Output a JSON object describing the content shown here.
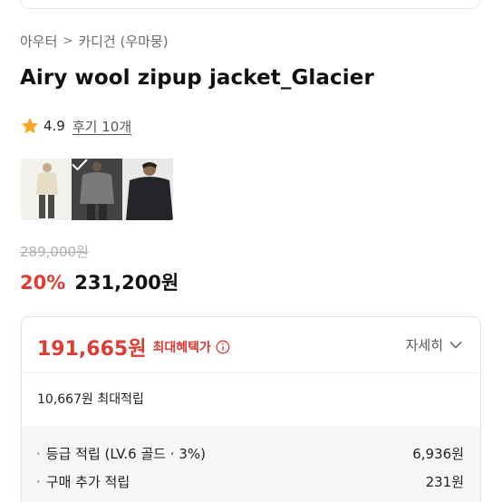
{
  "breadcrumb": {
    "parent": "아우터",
    "separator": ">",
    "current": "카디건 (우마뭉)"
  },
  "product": {
    "title": "Airy wool zipup jacket_Glacier"
  },
  "rating": {
    "score": "4.9",
    "reviews_label": "후기 10개"
  },
  "thumbnails": [
    {
      "alt": "light jacket front view"
    },
    {
      "alt": "grey jacket selected"
    },
    {
      "alt": "dark jacket model"
    }
  ],
  "price": {
    "original": "289,000원",
    "discount_rate": "20%",
    "sale": "231,200원"
  },
  "benefit": {
    "max_price": "191,665원",
    "max_label": "최대혜택가",
    "details_label": "자세히",
    "points_total": "10,667원 최대적립",
    "rows": [
      {
        "label": "등급 적립 (LV.6 골드 · 3%)",
        "value": "6,936원"
      },
      {
        "label": "구매 추가 적립",
        "value": "231원"
      }
    ]
  },
  "colors": {
    "accent_red": "#e03b32",
    "star": "#f5a623",
    "muted": "#b0b0b0"
  },
  "icons": {
    "star": "star-icon",
    "info": "info-icon",
    "chevron": "chevron-down-icon",
    "check": "check-icon"
  }
}
